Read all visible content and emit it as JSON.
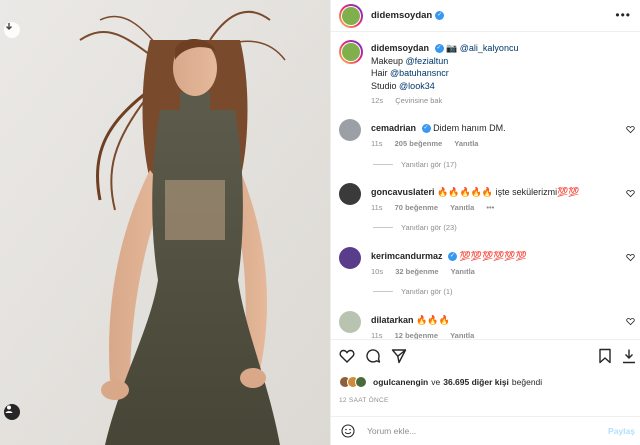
{
  "post": {
    "username": "didemsoydan",
    "more_label": "•••",
    "caption": {
      "camera_emoji": "📷",
      "photographer": "@ali_kalyoncu",
      "makeup_label": "Makeup",
      "makeup_handle": "@fezialtun",
      "hair_label": "Hair",
      "hair_handle": "@batuhansncr",
      "studio_label": "Studio",
      "studio_handle": "@look34",
      "age": "12s",
      "translate": "Çevirisine bak"
    },
    "comments": [
      {
        "user": "cemadrian",
        "text": "Didem hanım DM.",
        "age": "11s",
        "likes": "205 beğenme",
        "reply": "Yanıtla",
        "replies": "Yanıtları gör (17)",
        "avatar_color": "#9aa0a6"
      },
      {
        "user": "goncavuslateri",
        "text": "🔥🔥🔥🔥🔥 işte sekülerizmi💯💯",
        "age": "11s",
        "likes": "70 beğenme",
        "reply": "Yanıtla",
        "extra": "•••",
        "replies": "Yanıtları gör (23)",
        "avatar_color": "#3a3a3a"
      },
      {
        "user": "kerimcandurmaz",
        "text": "💯💯💯💯💯💯",
        "age": "10s",
        "likes": "32 beğenme",
        "reply": "Yanıtla",
        "replies": "Yanıtları gör (1)",
        "avatar_color": "#5a3d8a"
      },
      {
        "user": "dilatarkan",
        "text": "🔥🔥🔥",
        "age": "11s",
        "likes": "12 beğenme",
        "reply": "Yanıtla",
        "avatar_color": "#b8c4b0"
      }
    ],
    "likes": {
      "user": "ogulcanengin",
      "connector": "ve",
      "count": "36.695 diğer kişi",
      "suffix": "beğendi"
    },
    "timestamp": "12 SAAT ÖNCE",
    "comment_placeholder": "Yorum ekle...",
    "share_label": "Paylaş"
  },
  "icons": {
    "download": "download-icon",
    "tagged_user": "user-icon",
    "heart": "heart-icon",
    "comment": "comment-icon",
    "share": "send-icon",
    "save": "bookmark-icon",
    "emoji": "smiley-icon"
  },
  "colors": {
    "verified": "#3897f0",
    "link": "#00376b",
    "secondary_text": "#8e8e8e",
    "share_disabled": "#b2dffc"
  }
}
